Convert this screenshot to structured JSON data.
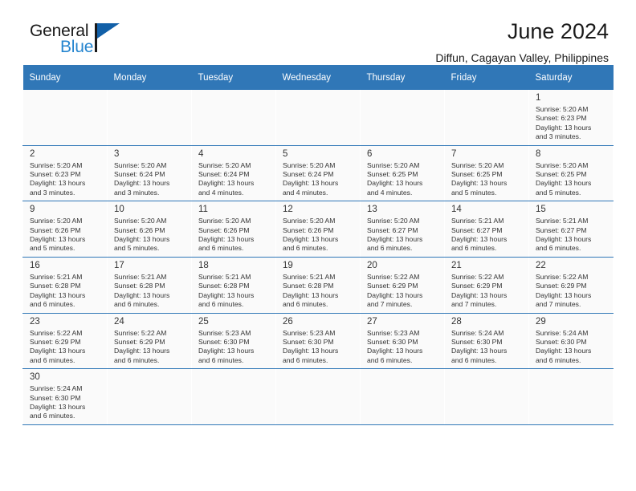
{
  "brand": {
    "line1": "General",
    "line2": "Blue",
    "triangle_color": "#1260a8",
    "line2_color": "#2585cf"
  },
  "header": {
    "title": "June 2024",
    "subtitle": "Diffun, Cagayan Valley, Philippines"
  },
  "theme": {
    "header_row_bg": "#3077b7",
    "header_row_text": "#ffffff",
    "cell_bg": "#fafafa",
    "grid_line": "#3077b7"
  },
  "calendar": {
    "weekday_headers": [
      "Sunday",
      "Monday",
      "Tuesday",
      "Wednesday",
      "Thursday",
      "Friday",
      "Saturday"
    ],
    "weeks": [
      [
        {
          "day": "",
          "info": ""
        },
        {
          "day": "",
          "info": ""
        },
        {
          "day": "",
          "info": ""
        },
        {
          "day": "",
          "info": ""
        },
        {
          "day": "",
          "info": ""
        },
        {
          "day": "",
          "info": ""
        },
        {
          "day": "1",
          "info": "Sunrise: 5:20 AM\nSunset: 6:23 PM\nDaylight: 13 hours\nand 3 minutes."
        }
      ],
      [
        {
          "day": "2",
          "info": "Sunrise: 5:20 AM\nSunset: 6:23 PM\nDaylight: 13 hours\nand 3 minutes."
        },
        {
          "day": "3",
          "info": "Sunrise: 5:20 AM\nSunset: 6:24 PM\nDaylight: 13 hours\nand 3 minutes."
        },
        {
          "day": "4",
          "info": "Sunrise: 5:20 AM\nSunset: 6:24 PM\nDaylight: 13 hours\nand 4 minutes."
        },
        {
          "day": "5",
          "info": "Sunrise: 5:20 AM\nSunset: 6:24 PM\nDaylight: 13 hours\nand 4 minutes."
        },
        {
          "day": "6",
          "info": "Sunrise: 5:20 AM\nSunset: 6:25 PM\nDaylight: 13 hours\nand 4 minutes."
        },
        {
          "day": "7",
          "info": "Sunrise: 5:20 AM\nSunset: 6:25 PM\nDaylight: 13 hours\nand 5 minutes."
        },
        {
          "day": "8",
          "info": "Sunrise: 5:20 AM\nSunset: 6:25 PM\nDaylight: 13 hours\nand 5 minutes."
        }
      ],
      [
        {
          "day": "9",
          "info": "Sunrise: 5:20 AM\nSunset: 6:26 PM\nDaylight: 13 hours\nand 5 minutes."
        },
        {
          "day": "10",
          "info": "Sunrise: 5:20 AM\nSunset: 6:26 PM\nDaylight: 13 hours\nand 5 minutes."
        },
        {
          "day": "11",
          "info": "Sunrise: 5:20 AM\nSunset: 6:26 PM\nDaylight: 13 hours\nand 6 minutes."
        },
        {
          "day": "12",
          "info": "Sunrise: 5:20 AM\nSunset: 6:26 PM\nDaylight: 13 hours\nand 6 minutes."
        },
        {
          "day": "13",
          "info": "Sunrise: 5:20 AM\nSunset: 6:27 PM\nDaylight: 13 hours\nand 6 minutes."
        },
        {
          "day": "14",
          "info": "Sunrise: 5:21 AM\nSunset: 6:27 PM\nDaylight: 13 hours\nand 6 minutes."
        },
        {
          "day": "15",
          "info": "Sunrise: 5:21 AM\nSunset: 6:27 PM\nDaylight: 13 hours\nand 6 minutes."
        }
      ],
      [
        {
          "day": "16",
          "info": "Sunrise: 5:21 AM\nSunset: 6:28 PM\nDaylight: 13 hours\nand 6 minutes."
        },
        {
          "day": "17",
          "info": "Sunrise: 5:21 AM\nSunset: 6:28 PM\nDaylight: 13 hours\nand 6 minutes."
        },
        {
          "day": "18",
          "info": "Sunrise: 5:21 AM\nSunset: 6:28 PM\nDaylight: 13 hours\nand 6 minutes."
        },
        {
          "day": "19",
          "info": "Sunrise: 5:21 AM\nSunset: 6:28 PM\nDaylight: 13 hours\nand 6 minutes."
        },
        {
          "day": "20",
          "info": "Sunrise: 5:22 AM\nSunset: 6:29 PM\nDaylight: 13 hours\nand 7 minutes."
        },
        {
          "day": "21",
          "info": "Sunrise: 5:22 AM\nSunset: 6:29 PM\nDaylight: 13 hours\nand 7 minutes."
        },
        {
          "day": "22",
          "info": "Sunrise: 5:22 AM\nSunset: 6:29 PM\nDaylight: 13 hours\nand 7 minutes."
        }
      ],
      [
        {
          "day": "23",
          "info": "Sunrise: 5:22 AM\nSunset: 6:29 PM\nDaylight: 13 hours\nand 6 minutes."
        },
        {
          "day": "24",
          "info": "Sunrise: 5:22 AM\nSunset: 6:29 PM\nDaylight: 13 hours\nand 6 minutes."
        },
        {
          "day": "25",
          "info": "Sunrise: 5:23 AM\nSunset: 6:30 PM\nDaylight: 13 hours\nand 6 minutes."
        },
        {
          "day": "26",
          "info": "Sunrise: 5:23 AM\nSunset: 6:30 PM\nDaylight: 13 hours\nand 6 minutes."
        },
        {
          "day": "27",
          "info": "Sunrise: 5:23 AM\nSunset: 6:30 PM\nDaylight: 13 hours\nand 6 minutes."
        },
        {
          "day": "28",
          "info": "Sunrise: 5:24 AM\nSunset: 6:30 PM\nDaylight: 13 hours\nand 6 minutes."
        },
        {
          "day": "29",
          "info": "Sunrise: 5:24 AM\nSunset: 6:30 PM\nDaylight: 13 hours\nand 6 minutes."
        }
      ],
      [
        {
          "day": "30",
          "info": "Sunrise: 5:24 AM\nSunset: 6:30 PM\nDaylight: 13 hours\nand 6 minutes."
        },
        {
          "day": "",
          "info": ""
        },
        {
          "day": "",
          "info": ""
        },
        {
          "day": "",
          "info": ""
        },
        {
          "day": "",
          "info": ""
        },
        {
          "day": "",
          "info": ""
        },
        {
          "day": "",
          "info": ""
        }
      ]
    ]
  }
}
